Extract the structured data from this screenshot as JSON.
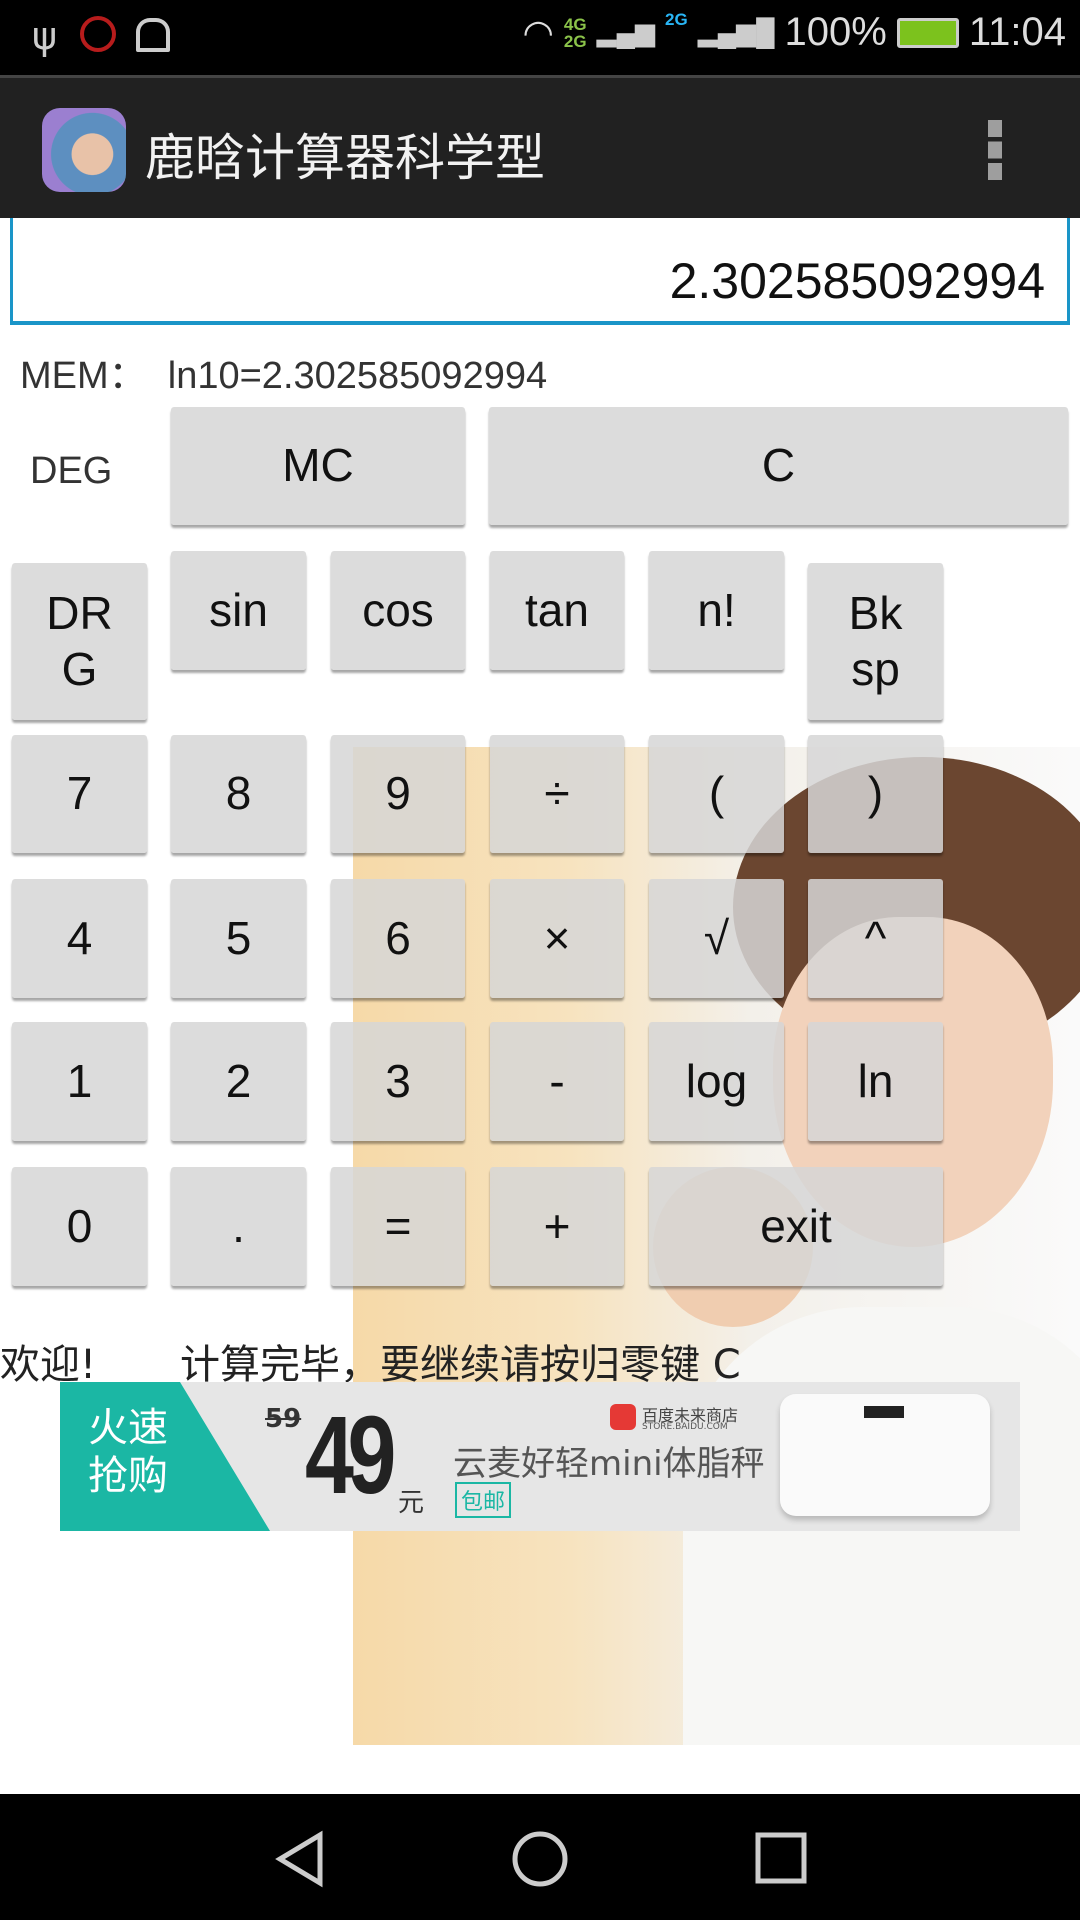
{
  "status_bar": {
    "network_4g": "4G",
    "network_2g_a": "2G",
    "network_2g_b": "2G",
    "battery": "100%",
    "time": "11:04",
    "battery_color": "#7cc21d"
  },
  "app_bar": {
    "title": "鹿晗计算器科学型"
  },
  "display": {
    "value": "2.302585092994",
    "accent": "#1a95c8"
  },
  "memory": {
    "text": "MEM：  ln10=2.302585092994"
  },
  "angle_mode": "DEG",
  "buttons": {
    "mc": "MC",
    "c": "C",
    "drg": "DR\nG",
    "sin": "sin",
    "cos": "cos",
    "tan": "tan",
    "fact": "n!",
    "bksp": "Bk\nsp",
    "n7": "7",
    "n8": "8",
    "n9": "9",
    "div": "÷",
    "lp": "(",
    "rp": ")",
    "n4": "4",
    "n5": "5",
    "n6": "6",
    "mul": "×",
    "sqrt": "√",
    "pow": "^",
    "n1": "1",
    "n2": "2",
    "n3": "3",
    "sub": "-",
    "log": "log",
    "ln": "ln",
    "n0": "0",
    "dot": ".",
    "eq": "=",
    "add": "+",
    "exit": "exit"
  },
  "status": {
    "welcome": "欢迎!",
    "message": "计算完毕，要继续请按归零键 C"
  },
  "ad": {
    "tag": "火速\n抢购",
    "old_price": "59",
    "price": "49",
    "unit": "元",
    "store": "百度未来商店",
    "store_url_text": "STORE.BAIDU.COM",
    "product": "云麦好轻mini体脂秤",
    "shipping": "包邮",
    "accent": "#1bb7a4"
  }
}
